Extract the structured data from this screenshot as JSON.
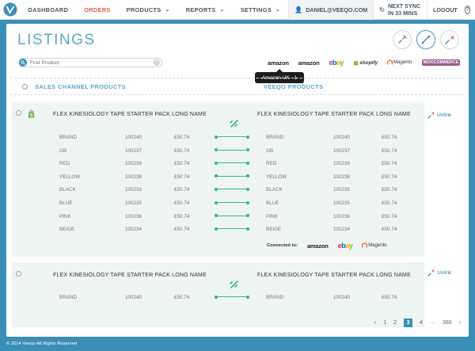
{
  "nav": {
    "items": [
      {
        "id": "dashboard",
        "label": "DASHBOARD",
        "active": false,
        "caret": false
      },
      {
        "id": "orders",
        "label": "ORDERS",
        "active": true,
        "caret": false
      },
      {
        "id": "products",
        "label": "PRODUCTS",
        "active": false,
        "caret": true
      },
      {
        "id": "reports",
        "label": "REPORTS",
        "active": false,
        "caret": true
      },
      {
        "id": "settings",
        "label": "SETTINGS",
        "active": false,
        "caret": true
      }
    ],
    "user_email": "DANIEL@VEEQO.COM",
    "sync_text": "NEXT SYNC IN 33 MINS",
    "logout_label": "LOGOUT",
    "help_label": "?"
  },
  "page": {
    "title": "LISTINGS",
    "search_placeholder": "Find Product"
  },
  "channels": [
    "amazon",
    "amazon",
    "ebay",
    "shopify",
    "Magento",
    "WOOCOMMERCE"
  ],
  "tooltip": "Amazon UK - 1",
  "headers": {
    "left": "SALES CHANNEL PRODUCTS",
    "right": "VEEQO PRODUCTS"
  },
  "product1": {
    "left_name": "FLEX KINESIOLOGY TAPE STARTER PACK LONG NAME",
    "right_name": "FLEX KINESIOLOGY TAPE STARTER PACK LONG NAME",
    "unlink_label": "Unlink",
    "rows": [
      {
        "lv": "BRAND",
        "lsku": "100240",
        "lp": "£50.74",
        "rv": "BRAND",
        "rsku": "100240",
        "rp": "£50.74"
      },
      {
        "lv": "GB",
        "lsku": "100237",
        "lp": "£50.74",
        "rv": "GB",
        "rsku": "100237",
        "rp": "£50.74"
      },
      {
        "lv": "RED",
        "lsku": "100239",
        "lp": "£50.74",
        "rv": "RED",
        "rsku": "100239",
        "rp": "£50.74"
      },
      {
        "lv": "YELLOW",
        "lsku": "100238",
        "lp": "£50.74",
        "rv": "YELLOW",
        "rsku": "100238",
        "rp": "£50.74"
      },
      {
        "lv": "BLACK",
        "lsku": "100233",
        "lp": "£50.74",
        "rv": "BLACK",
        "rsku": "100235",
        "rp": "£50.74"
      },
      {
        "lv": "BLUE",
        "lsku": "100235",
        "lp": "£50.74",
        "rv": "BLUE",
        "rsku": "100235",
        "rp": "£50.74"
      },
      {
        "lv": "PINK",
        "lsku": "100236",
        "lp": "£50.74",
        "rv": "PINK",
        "rsku": "100236",
        "rp": "£50.74"
      },
      {
        "lv": "BEIGE",
        "lsku": "100234",
        "lp": "£50.74",
        "rv": "BEIGE",
        "rsku": "100234",
        "rp": "£50.74"
      }
    ],
    "connected_label": "Connected to:",
    "connected": [
      "amazon",
      "ebay",
      "Magento"
    ]
  },
  "product2": {
    "left_name": "FLEX KINESIOLOGY TAPE STARTER PACK LONG NAME",
    "right_name": "FLEX KINESIOLOGY TAPE STARTER PACK LONG NAME",
    "unlink_label": "Unlink",
    "rows": [
      {
        "lv": "BRAND",
        "lsku": "100240",
        "lp": "£50.74",
        "rv": "BRAND",
        "rsku": "100240",
        "rp": "£50.74"
      }
    ]
  },
  "pagination": {
    "prev": "‹",
    "pages": [
      "1",
      "2",
      "3",
      "4",
      "···",
      "380"
    ],
    "current": "3",
    "next": "›"
  },
  "footer": "© 2014 Veeqo All Rights Reserved",
  "colors": {
    "brand": "#3a8fb7",
    "active_nav": "#e25a4f",
    "link_green": "#2fb89a",
    "card_bg": "#eef5f3"
  }
}
